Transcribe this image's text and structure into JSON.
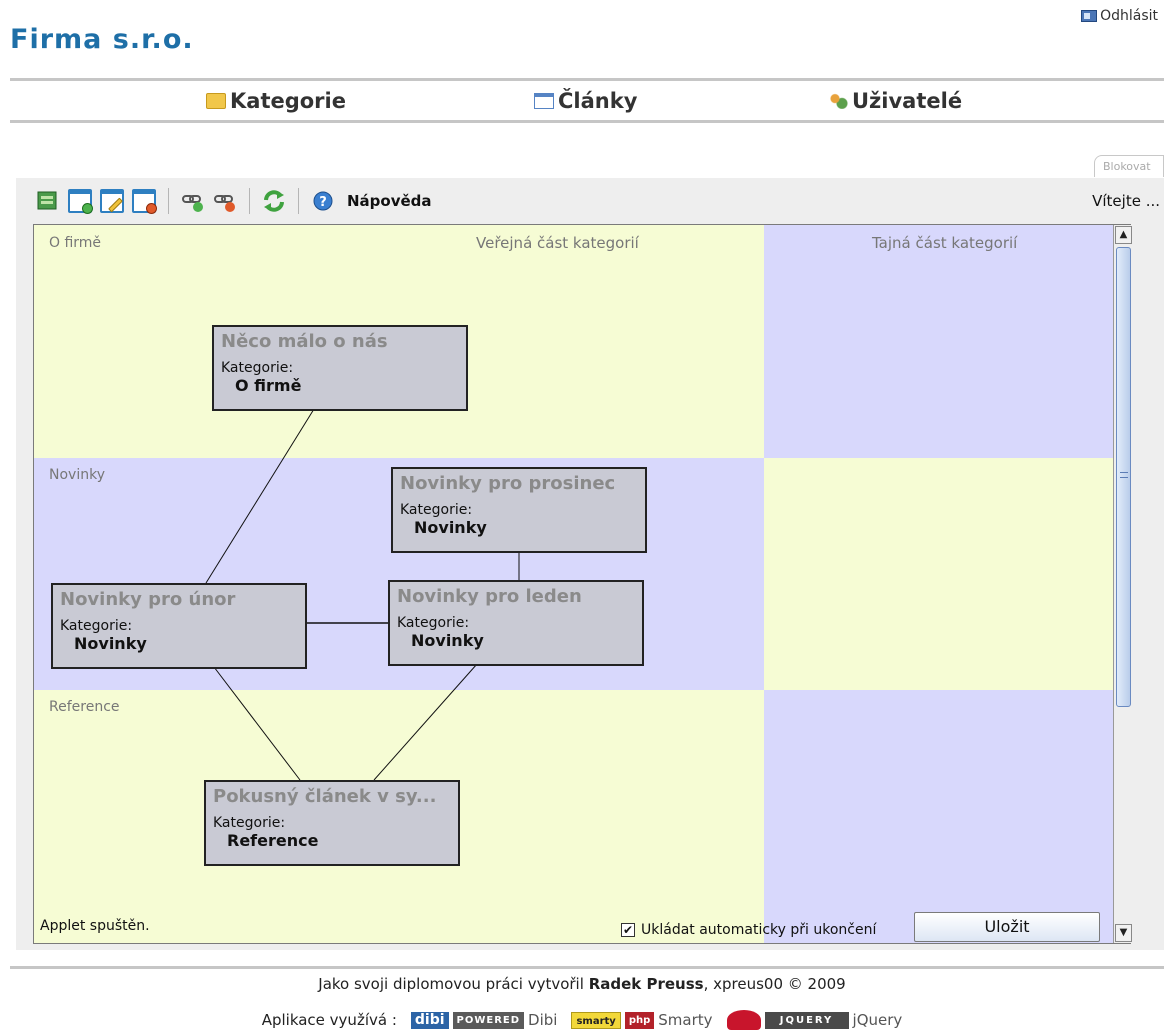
{
  "header": {
    "brand": "Firma s.r.o.",
    "logout_label": "Odhlásit"
  },
  "nav": {
    "items": [
      {
        "label": "Kategorie",
        "icon": "folder-icon"
      },
      {
        "label": "Články",
        "icon": "article-icon"
      },
      {
        "label": "Uživatelé",
        "icon": "users-icon"
      }
    ]
  },
  "applet": {
    "mode_tab_label": "Blokovat",
    "toolbar": {
      "help_label": "Nápověda",
      "icons": [
        "add-category-icon",
        "new-article-icon",
        "edit-article-icon",
        "delete-article-icon",
        "add-link-icon",
        "remove-link-icon",
        "refresh-icon",
        "help-icon"
      ]
    },
    "welcome": "Vítejte ...",
    "columns": {
      "public": "Veřejná část kategorií",
      "secret": "Tajná část kategorií"
    },
    "lanes": [
      "O firmě",
      "Novinky",
      "Reference"
    ],
    "category_label": "Kategorie:",
    "articles": [
      {
        "title": "Něco málo o nás",
        "category": "O firmě"
      },
      {
        "title": "Novinky pro prosinec",
        "category": "Novinky"
      },
      {
        "title": "Novinky pro únor",
        "category": "Novinky"
      },
      {
        "title": "Novinky pro leden",
        "category": "Novinky"
      },
      {
        "title": "Pokusný článek v sy...",
        "category": "Reference"
      }
    ],
    "status": "Applet spuštěn.",
    "autosave_label": "Ukládat automaticky při ukončení",
    "autosave_checked": true,
    "save_label": "Uložit"
  },
  "footer": {
    "credit_prefix": "Jako svoji diplomovou práci vytvořil",
    "author": "Radek Preuss",
    "credit_suffix": ", xpreus00 © 2009",
    "uses_label": "Aplikace využívá :",
    "libs": [
      {
        "name": "Dibi",
        "badge": "dibi",
        "badge2": "POWERED"
      },
      {
        "name": "Smarty",
        "badge": "smarty",
        "badge2": "php"
      },
      {
        "name": "jQuery",
        "badge": "",
        "badge2": "JQUERY"
      }
    ]
  }
}
